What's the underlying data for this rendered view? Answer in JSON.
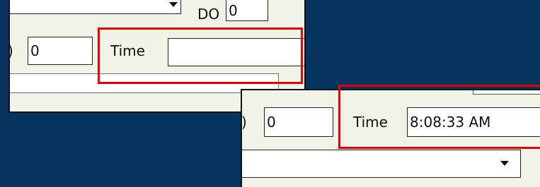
{
  "panel_top": {
    "do_label": "DO",
    "do_value": "0",
    "left_field_value": "0",
    "time_label": "Time",
    "time_value": "",
    "paren": ")"
  },
  "panel_bottom": {
    "left_field_value": "0",
    "time_label": "Time",
    "time_value": "8:08:33 AM",
    "paren": "c)"
  },
  "colors": {
    "background": "#07335f",
    "panel": "#f0f3e6",
    "highlight": "#e30000"
  },
  "icons": {
    "dropdown_arrow": "chevron-down-icon"
  }
}
